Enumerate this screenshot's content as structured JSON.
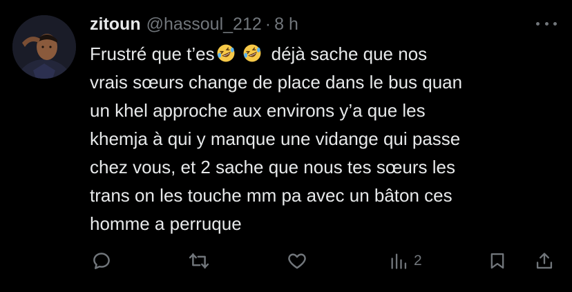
{
  "author": {
    "name": "zitoun",
    "handle": "@hassoul_212",
    "separator": "·",
    "time": "8 h"
  },
  "tweet": {
    "lines": [
      "Frustré que t’es",
      "déjà sache que nos",
      "vrais sœurs change de place dans le bus quan",
      "un khel approche aux environs y’a que les",
      "khemja à qui y manque une vidange qui passe",
      "chez vous, et 2 sache que nous tes sœurs les",
      "trans on les touche mm pa avec un bâton ces",
      "homme a perruque"
    ],
    "emojis": [
      "rolling-on-floor-laughing-emoji",
      "rolling-on-floor-laughing-emoji"
    ]
  },
  "actions": {
    "reply": {
      "icon": "reply-icon"
    },
    "retweet": {
      "icon": "retweet-icon"
    },
    "like": {
      "icon": "heart-icon"
    },
    "views": {
      "icon": "views-icon",
      "count": "2"
    },
    "bookmark": {
      "icon": "bookmark-icon"
    },
    "share": {
      "icon": "share-icon"
    }
  },
  "colors": {
    "background": "#000000",
    "text": "#e7e9ea",
    "secondary": "#71767b",
    "emoji": "#f7c948"
  }
}
